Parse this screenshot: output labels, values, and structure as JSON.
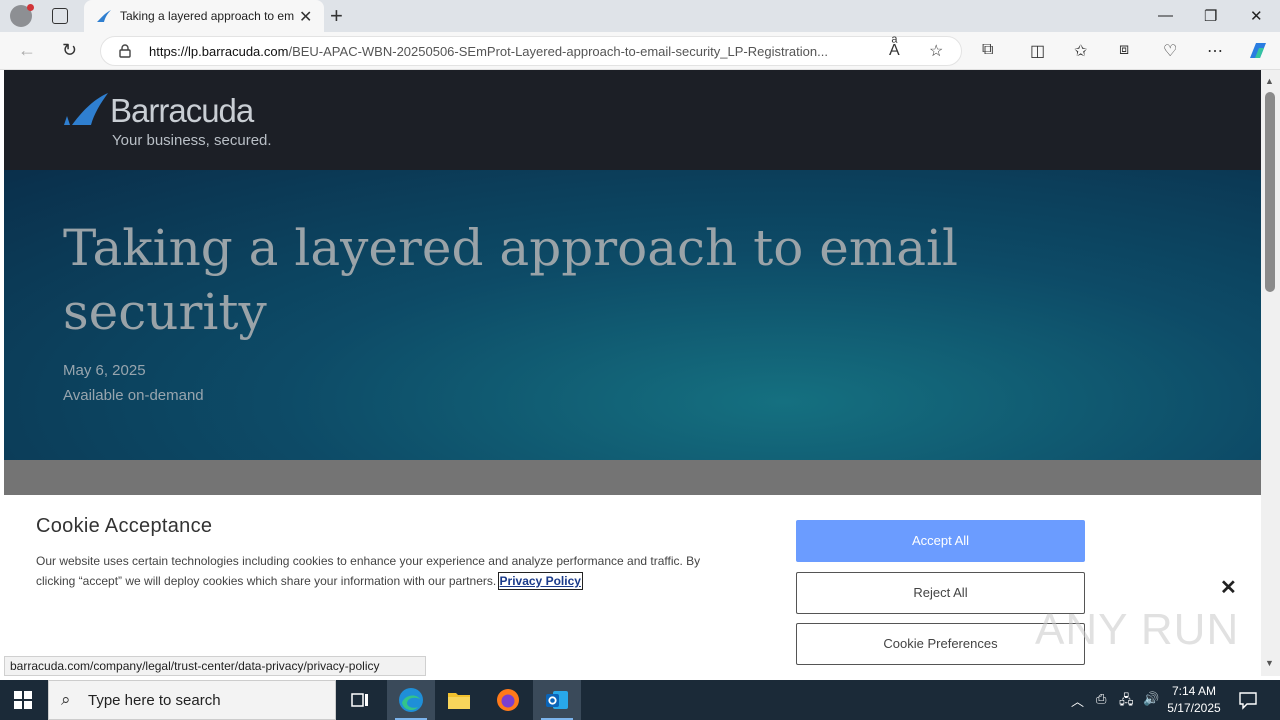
{
  "browser": {
    "tab_title": "Taking a layered approach to em",
    "url_host": "https://lp.barracuda.com",
    "url_path": "/BEU-APAC-WBN-20250506-SEmProt-Layered-approach-to-email-security_LP-Registration..."
  },
  "page": {
    "logo_word": "Barracuda",
    "logo_tagline": "Your business, secured.",
    "hero_title": "Taking a layered approach to email security",
    "date": "May 6, 2025",
    "availability": "Available on-demand"
  },
  "cookie": {
    "heading": "Cookie Acceptance",
    "body": "Our website uses certain technologies including cookies to enhance your experience and analyze performance and traffic. By clicking “accept” we will deploy cookies which share your information with our partners. ",
    "privacy_link": "Privacy Policy",
    "accept_label": "Accept All",
    "reject_label": "Reject All",
    "prefs_label": "Cookie Preferences"
  },
  "status_url": "barracuda.com/company/legal/trust-center/data-privacy/privacy-policy",
  "watermark": "ANY RUN",
  "taskbar": {
    "search_placeholder": "Type here to search",
    "time": "7:14 AM",
    "date": "5/17/2025"
  },
  "colors": {
    "accent_button": "#6b9cff",
    "header_bg": "#1c1f26",
    "hero_bg": "#0d4b67"
  }
}
